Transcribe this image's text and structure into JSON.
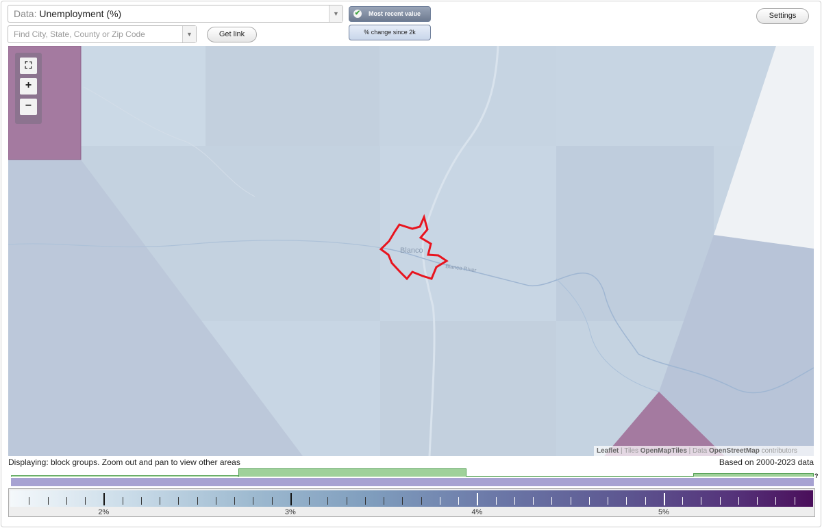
{
  "toolbar": {
    "data_prefix": "Data:",
    "data_value": "Unemployment (%)",
    "search_placeholder": "Find City, State, County or Zip Code",
    "get_link": "Get link",
    "settings": "Settings",
    "mode_active": "Most recent value",
    "mode_inactive": "% change since 2k"
  },
  "map": {
    "place_label": "Blanco",
    "river_label": "Blanco River",
    "zoom_fit_icon": "fullscreen-icon",
    "zoom_in": "+",
    "zoom_out": "−",
    "highlight_color": "#e8141e",
    "high_value_color": "#a47aa0",
    "attribution": {
      "leaflet": "Leaflet",
      "sep1": " | Tiles ",
      "tiles": "OpenMapTiles",
      "sep2": " | Data ",
      "data": "OpenStreetMap",
      "suffix": " contributors"
    }
  },
  "status": {
    "displaying": "Displaying: block groups. Zoom out and pan to view other areas",
    "based_on": "Based on 2000-2023 data"
  },
  "histogram": {
    "help": "?",
    "quartile_fill": "#9fd19a",
    "bar_fill": "#a7a2d2"
  },
  "legend": {
    "min": 1.5,
    "max": 5.8,
    "labels": [
      "2%",
      "3%",
      "4%",
      "5%"
    ],
    "label_values": [
      2,
      3,
      4,
      5
    ]
  }
}
